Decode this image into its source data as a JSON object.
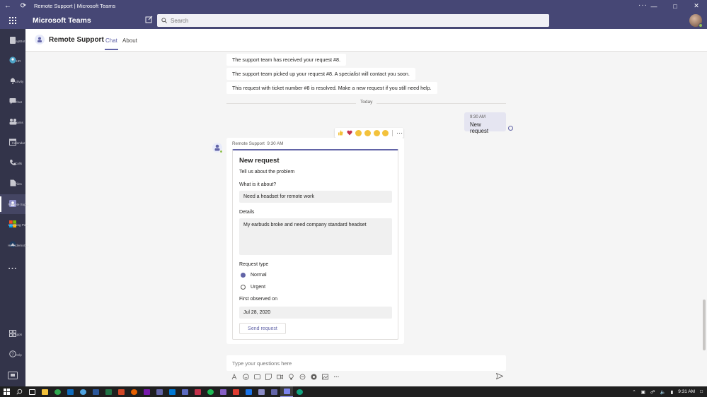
{
  "window": {
    "title": "Remote Support | Microsoft Teams"
  },
  "header": {
    "app_name": "Microsoft Teams",
    "search_placeholder": "Search"
  },
  "rail": {
    "items": [
      {
        "label": "AdaptBot",
        "icon": "bot-icon"
      },
      {
        "label": "HR",
        "icon": "hr-icon"
      },
      {
        "label": "Activity",
        "icon": "bell-icon"
      },
      {
        "label": "Chat",
        "icon": "chat-icon"
      },
      {
        "label": "Teams",
        "icon": "teams-icon"
      },
      {
        "label": "Calendar",
        "icon": "calendar-icon"
      },
      {
        "label": "Calls",
        "icon": "phone-icon"
      },
      {
        "label": "Files",
        "icon": "file-icon"
      },
      {
        "label": "Remote Sup...",
        "icon": "remote-support-icon"
      },
      {
        "label": "Learning Pa...",
        "icon": "learning-icon"
      },
      {
        "label": "HicksdemoC...",
        "icon": "app-icon"
      }
    ],
    "more": "...",
    "apps_label": "Apps",
    "help_label": "Help"
  },
  "channel": {
    "title": "Remote Support",
    "tabs": [
      {
        "label": "Chat"
      },
      {
        "label": "About"
      }
    ]
  },
  "messages": {
    "system": [
      "The support team has received your request #8.",
      "The support team picked up your request #8. A specialist will contact you soon.",
      "This request with ticket number #8 is resolved. Make a new request if you still need help."
    ],
    "divider": "Today",
    "mine": {
      "time": "9:30 AM",
      "text": "New request"
    },
    "bot": {
      "sender": "Remote Support",
      "time": "9:30 AM"
    }
  },
  "card": {
    "title": "New request",
    "subtitle": "Tell us about the problem",
    "about_label": "What is it about?",
    "about_value": "Need a headset for remote work",
    "details_label": "Details",
    "details_value": "My earbuds broke and need company standard headset",
    "request_type_label": "Request type",
    "options": [
      {
        "label": "Normal",
        "selected": true
      },
      {
        "label": "Urgent",
        "selected": false
      }
    ],
    "first_observed_label": "First observed on",
    "first_observed_value": "Jul 28, 2020",
    "send_label": "Send request"
  },
  "compose": {
    "placeholder": "Type your questions here"
  },
  "taskbar": {
    "time": "9:31 AM"
  },
  "colors": {
    "brand": "#464775",
    "accent": "#6264a7",
    "rail": "#33344a"
  }
}
